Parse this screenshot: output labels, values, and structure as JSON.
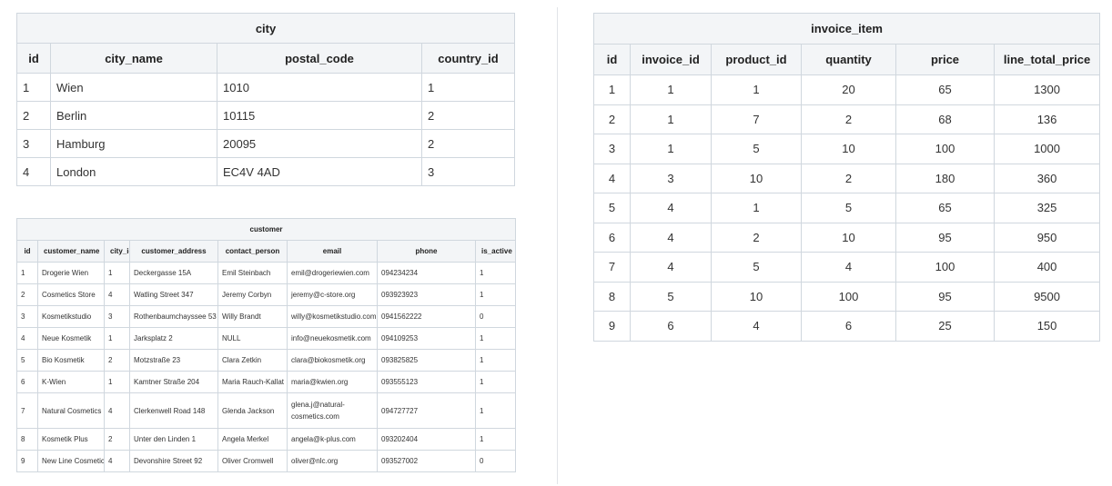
{
  "city": {
    "title": "city",
    "columns": [
      "id",
      "city_name",
      "postal_code",
      "country_id"
    ],
    "rows": [
      [
        "1",
        "Wien",
        "1010",
        "1"
      ],
      [
        "2",
        "Berlin",
        "10115",
        "2"
      ],
      [
        "3",
        "Hamburg",
        "20095",
        "2"
      ],
      [
        "4",
        "London",
        "EC4V 4AD",
        "3"
      ]
    ]
  },
  "customer": {
    "title": "customer",
    "columns": [
      "id",
      "customer_name",
      "city_id",
      "customer_address",
      "contact_person",
      "email",
      "phone",
      "is_active"
    ],
    "rows": [
      [
        "1",
        "Drogerie Wien",
        "1",
        "Deckergasse 15A",
        "Emil Steinbach",
        "emil@drogeriewien.com",
        "094234234",
        "1"
      ],
      [
        "2",
        "Cosmetics Store",
        "4",
        "Watling Street 347",
        "Jeremy Corbyn",
        "jeremy@c-store.org",
        "093923923",
        "1"
      ],
      [
        "3",
        "Kosmetikstudio",
        "3",
        "Rothenbaumchayssee 53",
        "Willy Brandt",
        "willy@kosmetikstudio.com",
        "0941562222",
        "0"
      ],
      [
        "4",
        "Neue Kosmetik",
        "1",
        "Jarksplatz 2",
        "NULL",
        "info@neuekosmetik.com",
        "094109253",
        "1"
      ],
      [
        "5",
        "Bio Kosmetik",
        "2",
        "Motzstraße 23",
        "Clara Zetkin",
        "clara@biokosmetik.org",
        "093825825",
        "1"
      ],
      [
        "6",
        "K-Wien",
        "1",
        "Kamtner Straße 204",
        "Maria Rauch-Kallat",
        "maria@kwien.org",
        "093555123",
        "1"
      ],
      [
        "7",
        "Natural Cosmetics",
        "4",
        "Clerkenwell Road 148",
        "Glenda Jackson",
        "glena.j@natural-cosmetics.com",
        "094727727",
        "1"
      ],
      [
        "8",
        "Kosmetik Plus",
        "2",
        "Unter den Linden 1",
        "Angela Merkel",
        "angela@k-plus.com",
        "093202404",
        "1"
      ],
      [
        "9",
        "New Line Cosmetics",
        "4",
        "Devonshire Street 92",
        "Oliver Cromwell",
        "oliver@nlc.org",
        "093527002",
        "0"
      ]
    ]
  },
  "invoice_item": {
    "title": "invoice_item",
    "columns": [
      "id",
      "invoice_id",
      "product_id",
      "quantity",
      "price",
      "line_total_price"
    ],
    "rows": [
      [
        "1",
        "1",
        "1",
        "20",
        "65",
        "1300"
      ],
      [
        "2",
        "1",
        "7",
        "2",
        "68",
        "136"
      ],
      [
        "3",
        "1",
        "5",
        "10",
        "100",
        "1000"
      ],
      [
        "4",
        "3",
        "10",
        "2",
        "180",
        "360"
      ],
      [
        "5",
        "4",
        "1",
        "5",
        "65",
        "325"
      ],
      [
        "6",
        "4",
        "2",
        "10",
        "95",
        "950"
      ],
      [
        "7",
        "4",
        "5",
        "4",
        "100",
        "400"
      ],
      [
        "8",
        "5",
        "10",
        "100",
        "95",
        "9500"
      ],
      [
        "9",
        "6",
        "4",
        "6",
        "25",
        "150"
      ]
    ]
  }
}
